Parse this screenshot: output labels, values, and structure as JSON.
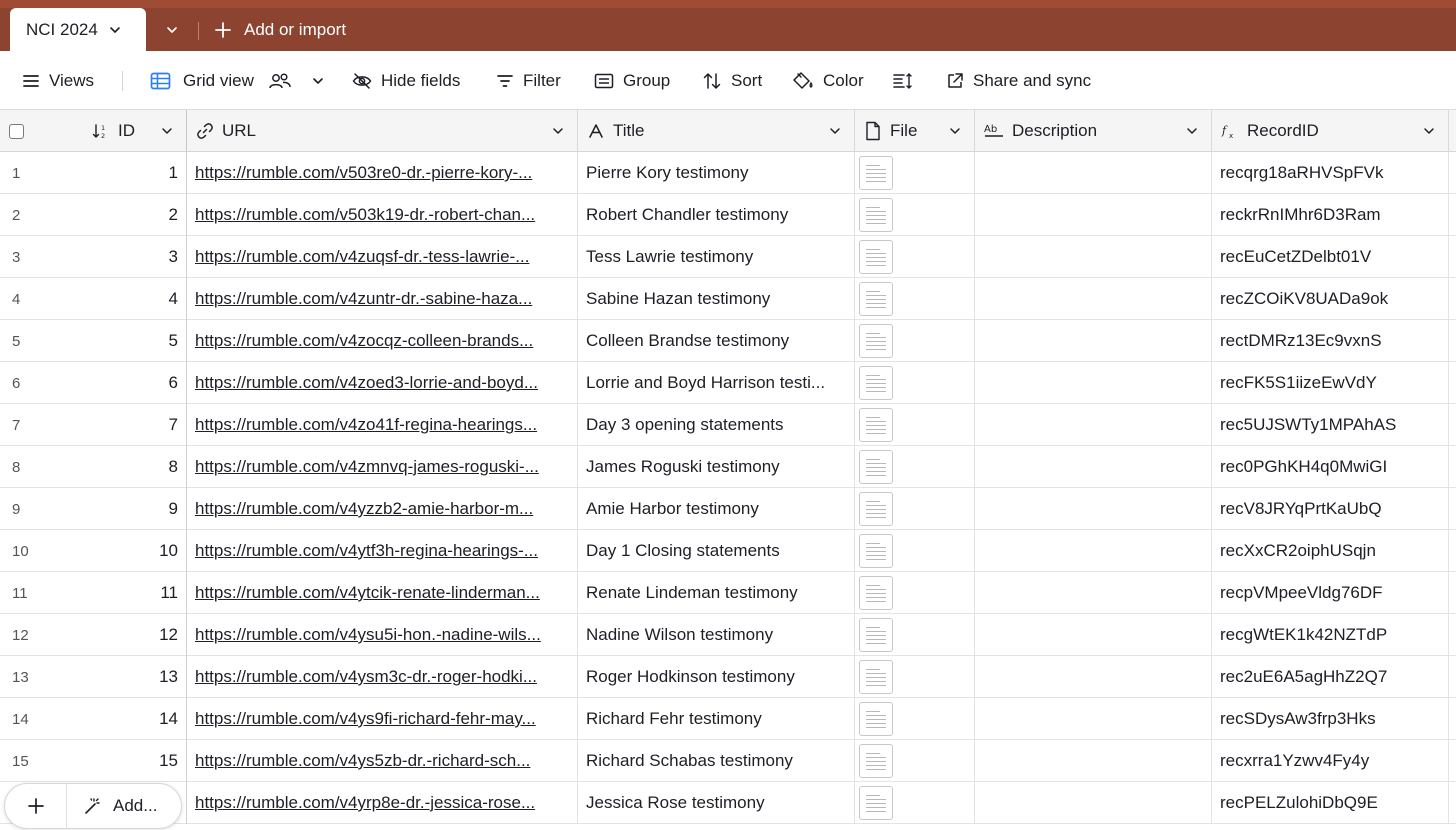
{
  "base": {
    "table_tab": "NCI 2024",
    "add_or_import": "Add or import"
  },
  "toolbar": {
    "views": "Views",
    "grid_view": "Grid view",
    "hide_fields": "Hide fields",
    "filter": "Filter",
    "group": "Group",
    "sort": "Sort",
    "color": "Color",
    "share_and_sync": "Share and sync"
  },
  "columns": {
    "id": "ID",
    "url": "URL",
    "title": "Title",
    "file": "File",
    "description": "Description",
    "record_id": "RecordID"
  },
  "rows": [
    {
      "n": "1",
      "id": "1",
      "url": "https://rumble.com/v503re0-dr.-pierre-kory-...",
      "title": "Pierre Kory testimony",
      "record_id": "recqrg18aRHVSpFVk"
    },
    {
      "n": "2",
      "id": "2",
      "url": "https://rumble.com/v503k19-dr.-robert-chan...",
      "title": "Robert Chandler testimony",
      "record_id": "reckrRnIMhr6D3Ram"
    },
    {
      "n": "3",
      "id": "3",
      "url": "https://rumble.com/v4zuqsf-dr.-tess-lawrie-...",
      "title": "Tess Lawrie testimony",
      "record_id": "recEuCetZDelbt01V"
    },
    {
      "n": "4",
      "id": "4",
      "url": "https://rumble.com/v4zuntr-dr.-sabine-haza...",
      "title": "Sabine Hazan testimony",
      "record_id": "recZCOiKV8UADa9ok"
    },
    {
      "n": "5",
      "id": "5",
      "url": "https://rumble.com/v4zocqz-colleen-brands...",
      "title": "Colleen Brandse testimony",
      "record_id": "rectDMRz13Ec9vxnS"
    },
    {
      "n": "6",
      "id": "6",
      "url": "https://rumble.com/v4zoed3-lorrie-and-boyd...",
      "title": "Lorrie and Boyd Harrison testi...",
      "record_id": "recFK5S1iizeEwVdY"
    },
    {
      "n": "7",
      "id": "7",
      "url": "https://rumble.com/v4zo41f-regina-hearings...",
      "title": "Day 3 opening statements",
      "record_id": "rec5UJSWTy1MPAhAS"
    },
    {
      "n": "8",
      "id": "8",
      "url": "https://rumble.com/v4zmnvq-james-roguski-...",
      "title": "James Roguski testimony",
      "record_id": "rec0PGhKH4q0MwiGI"
    },
    {
      "n": "9",
      "id": "9",
      "url": "https://rumble.com/v4yzzb2-amie-harbor-m...",
      "title": "Amie Harbor testimony",
      "record_id": "recV8JRYqPrtKaUbQ"
    },
    {
      "n": "10",
      "id": "10",
      "url": "https://rumble.com/v4ytf3h-regina-hearings-...",
      "title": "Day 1 Closing statements",
      "record_id": "recXxCR2oiphUSqjn"
    },
    {
      "n": "11",
      "id": "11",
      "url": "https://rumble.com/v4ytcik-renate-linderman...",
      "title": "Renate Lindeman testimony",
      "record_id": "recpVMpeeVldg76DF"
    },
    {
      "n": "12",
      "id": "12",
      "url": "https://rumble.com/v4ysu5i-hon.-nadine-wils...",
      "title": "Nadine Wilson testimony",
      "record_id": "recgWtEK1k42NZTdP"
    },
    {
      "n": "13",
      "id": "13",
      "url": "https://rumble.com/v4ysm3c-dr.-roger-hodki...",
      "title": "Roger Hodkinson testimony",
      "record_id": "rec2uE6A5agHhZ2Q7"
    },
    {
      "n": "14",
      "id": "14",
      "url": "https://rumble.com/v4ys9fi-richard-fehr-may...",
      "title": "Richard Fehr testimony",
      "record_id": "recSDysAw3frp3Hks"
    },
    {
      "n": "15",
      "id": "15",
      "url": "https://rumble.com/v4ys5zb-dr.-richard-sch...",
      "title": "Richard Schabas testimony",
      "record_id": "recxrra1Yzwv4Fy4y"
    },
    {
      "n": "",
      "id": "",
      "url": "https://rumble.com/v4yrp8e-dr.-jessica-rose...",
      "title": "Jessica Rose testimony",
      "record_id": "recPELZulohiDbQ9E"
    }
  ],
  "footer": {
    "add_more": "Add..."
  },
  "colors": {
    "topbar": "#8c4330",
    "header_bg": "#f5f5f5"
  }
}
